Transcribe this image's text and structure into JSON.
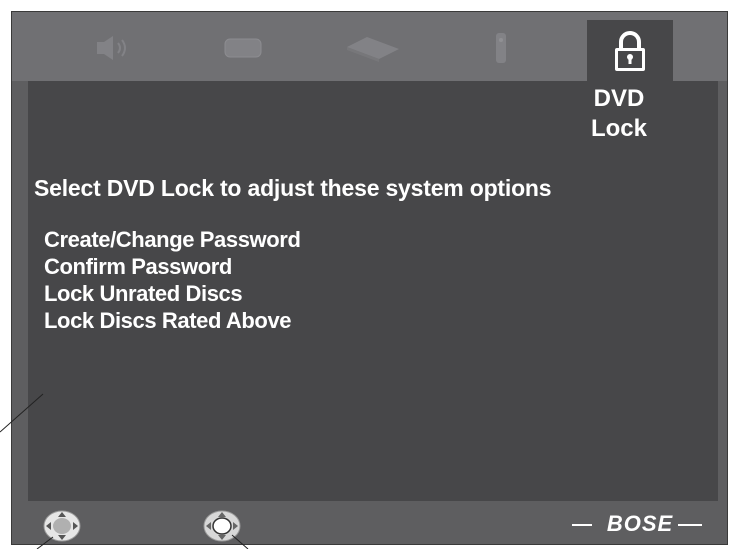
{
  "tabs": [
    {
      "name": "audio",
      "icon": "speaker-icon"
    },
    {
      "name": "video",
      "icon": "tv-screen-icon"
    },
    {
      "name": "disc",
      "icon": "disc-tray-icon"
    },
    {
      "name": "remote",
      "icon": "remote-control-icon"
    },
    {
      "name": "dvd-lock",
      "icon": "padlock-icon",
      "active": true
    }
  ],
  "panel": {
    "title_line1": "DVD",
    "title_line2": "Lock",
    "heading": "Select DVD Lock to adjust these system options",
    "options": [
      "Create/Change Password",
      "Confirm Password",
      "Lock Unrated Discs",
      "Lock Discs Rated Above"
    ]
  },
  "bottom_bar": {
    "logo": "BOSE",
    "left_pad_icon": "navigation-pad-icon",
    "right_pad_icon": "navigation-pad-select-icon"
  },
  "colors": {
    "frame": "#5e5e60",
    "tab_strip": "#707073",
    "panel": "#474749",
    "text": "#ffffff"
  }
}
